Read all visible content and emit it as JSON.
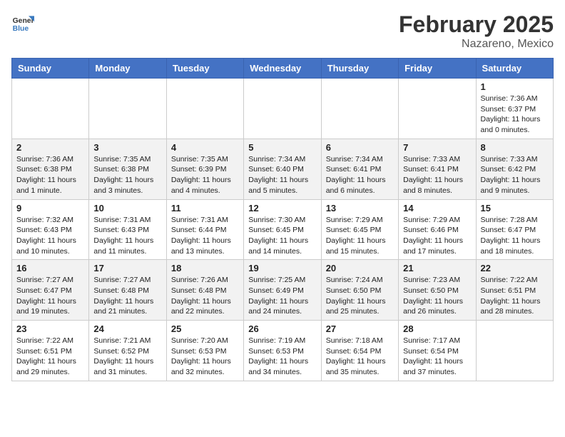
{
  "header": {
    "logo_general": "General",
    "logo_blue": "Blue",
    "month_title": "February 2025",
    "location": "Nazareno, Mexico"
  },
  "weekdays": [
    "Sunday",
    "Monday",
    "Tuesday",
    "Wednesday",
    "Thursday",
    "Friday",
    "Saturday"
  ],
  "weeks": [
    [
      {
        "day": "",
        "info": ""
      },
      {
        "day": "",
        "info": ""
      },
      {
        "day": "",
        "info": ""
      },
      {
        "day": "",
        "info": ""
      },
      {
        "day": "",
        "info": ""
      },
      {
        "day": "",
        "info": ""
      },
      {
        "day": "1",
        "info": "Sunrise: 7:36 AM\nSunset: 6:37 PM\nDaylight: 11 hours\nand 0 minutes."
      }
    ],
    [
      {
        "day": "2",
        "info": "Sunrise: 7:36 AM\nSunset: 6:38 PM\nDaylight: 11 hours\nand 1 minute."
      },
      {
        "day": "3",
        "info": "Sunrise: 7:35 AM\nSunset: 6:38 PM\nDaylight: 11 hours\nand 3 minutes."
      },
      {
        "day": "4",
        "info": "Sunrise: 7:35 AM\nSunset: 6:39 PM\nDaylight: 11 hours\nand 4 minutes."
      },
      {
        "day": "5",
        "info": "Sunrise: 7:34 AM\nSunset: 6:40 PM\nDaylight: 11 hours\nand 5 minutes."
      },
      {
        "day": "6",
        "info": "Sunrise: 7:34 AM\nSunset: 6:41 PM\nDaylight: 11 hours\nand 6 minutes."
      },
      {
        "day": "7",
        "info": "Sunrise: 7:33 AM\nSunset: 6:41 PM\nDaylight: 11 hours\nand 8 minutes."
      },
      {
        "day": "8",
        "info": "Sunrise: 7:33 AM\nSunset: 6:42 PM\nDaylight: 11 hours\nand 9 minutes."
      }
    ],
    [
      {
        "day": "9",
        "info": "Sunrise: 7:32 AM\nSunset: 6:43 PM\nDaylight: 11 hours\nand 10 minutes."
      },
      {
        "day": "10",
        "info": "Sunrise: 7:31 AM\nSunset: 6:43 PM\nDaylight: 11 hours\nand 11 minutes."
      },
      {
        "day": "11",
        "info": "Sunrise: 7:31 AM\nSunset: 6:44 PM\nDaylight: 11 hours\nand 13 minutes."
      },
      {
        "day": "12",
        "info": "Sunrise: 7:30 AM\nSunset: 6:45 PM\nDaylight: 11 hours\nand 14 minutes."
      },
      {
        "day": "13",
        "info": "Sunrise: 7:29 AM\nSunset: 6:45 PM\nDaylight: 11 hours\nand 15 minutes."
      },
      {
        "day": "14",
        "info": "Sunrise: 7:29 AM\nSunset: 6:46 PM\nDaylight: 11 hours\nand 17 minutes."
      },
      {
        "day": "15",
        "info": "Sunrise: 7:28 AM\nSunset: 6:47 PM\nDaylight: 11 hours\nand 18 minutes."
      }
    ],
    [
      {
        "day": "16",
        "info": "Sunrise: 7:27 AM\nSunset: 6:47 PM\nDaylight: 11 hours\nand 19 minutes."
      },
      {
        "day": "17",
        "info": "Sunrise: 7:27 AM\nSunset: 6:48 PM\nDaylight: 11 hours\nand 21 minutes."
      },
      {
        "day": "18",
        "info": "Sunrise: 7:26 AM\nSunset: 6:48 PM\nDaylight: 11 hours\nand 22 minutes."
      },
      {
        "day": "19",
        "info": "Sunrise: 7:25 AM\nSunset: 6:49 PM\nDaylight: 11 hours\nand 24 minutes."
      },
      {
        "day": "20",
        "info": "Sunrise: 7:24 AM\nSunset: 6:50 PM\nDaylight: 11 hours\nand 25 minutes."
      },
      {
        "day": "21",
        "info": "Sunrise: 7:23 AM\nSunset: 6:50 PM\nDaylight: 11 hours\nand 26 minutes."
      },
      {
        "day": "22",
        "info": "Sunrise: 7:22 AM\nSunset: 6:51 PM\nDaylight: 11 hours\nand 28 minutes."
      }
    ],
    [
      {
        "day": "23",
        "info": "Sunrise: 7:22 AM\nSunset: 6:51 PM\nDaylight: 11 hours\nand 29 minutes."
      },
      {
        "day": "24",
        "info": "Sunrise: 7:21 AM\nSunset: 6:52 PM\nDaylight: 11 hours\nand 31 minutes."
      },
      {
        "day": "25",
        "info": "Sunrise: 7:20 AM\nSunset: 6:53 PM\nDaylight: 11 hours\nand 32 minutes."
      },
      {
        "day": "26",
        "info": "Sunrise: 7:19 AM\nSunset: 6:53 PM\nDaylight: 11 hours\nand 34 minutes."
      },
      {
        "day": "27",
        "info": "Sunrise: 7:18 AM\nSunset: 6:54 PM\nDaylight: 11 hours\nand 35 minutes."
      },
      {
        "day": "28",
        "info": "Sunrise: 7:17 AM\nSunset: 6:54 PM\nDaylight: 11 hours\nand 37 minutes."
      },
      {
        "day": "",
        "info": ""
      }
    ]
  ]
}
